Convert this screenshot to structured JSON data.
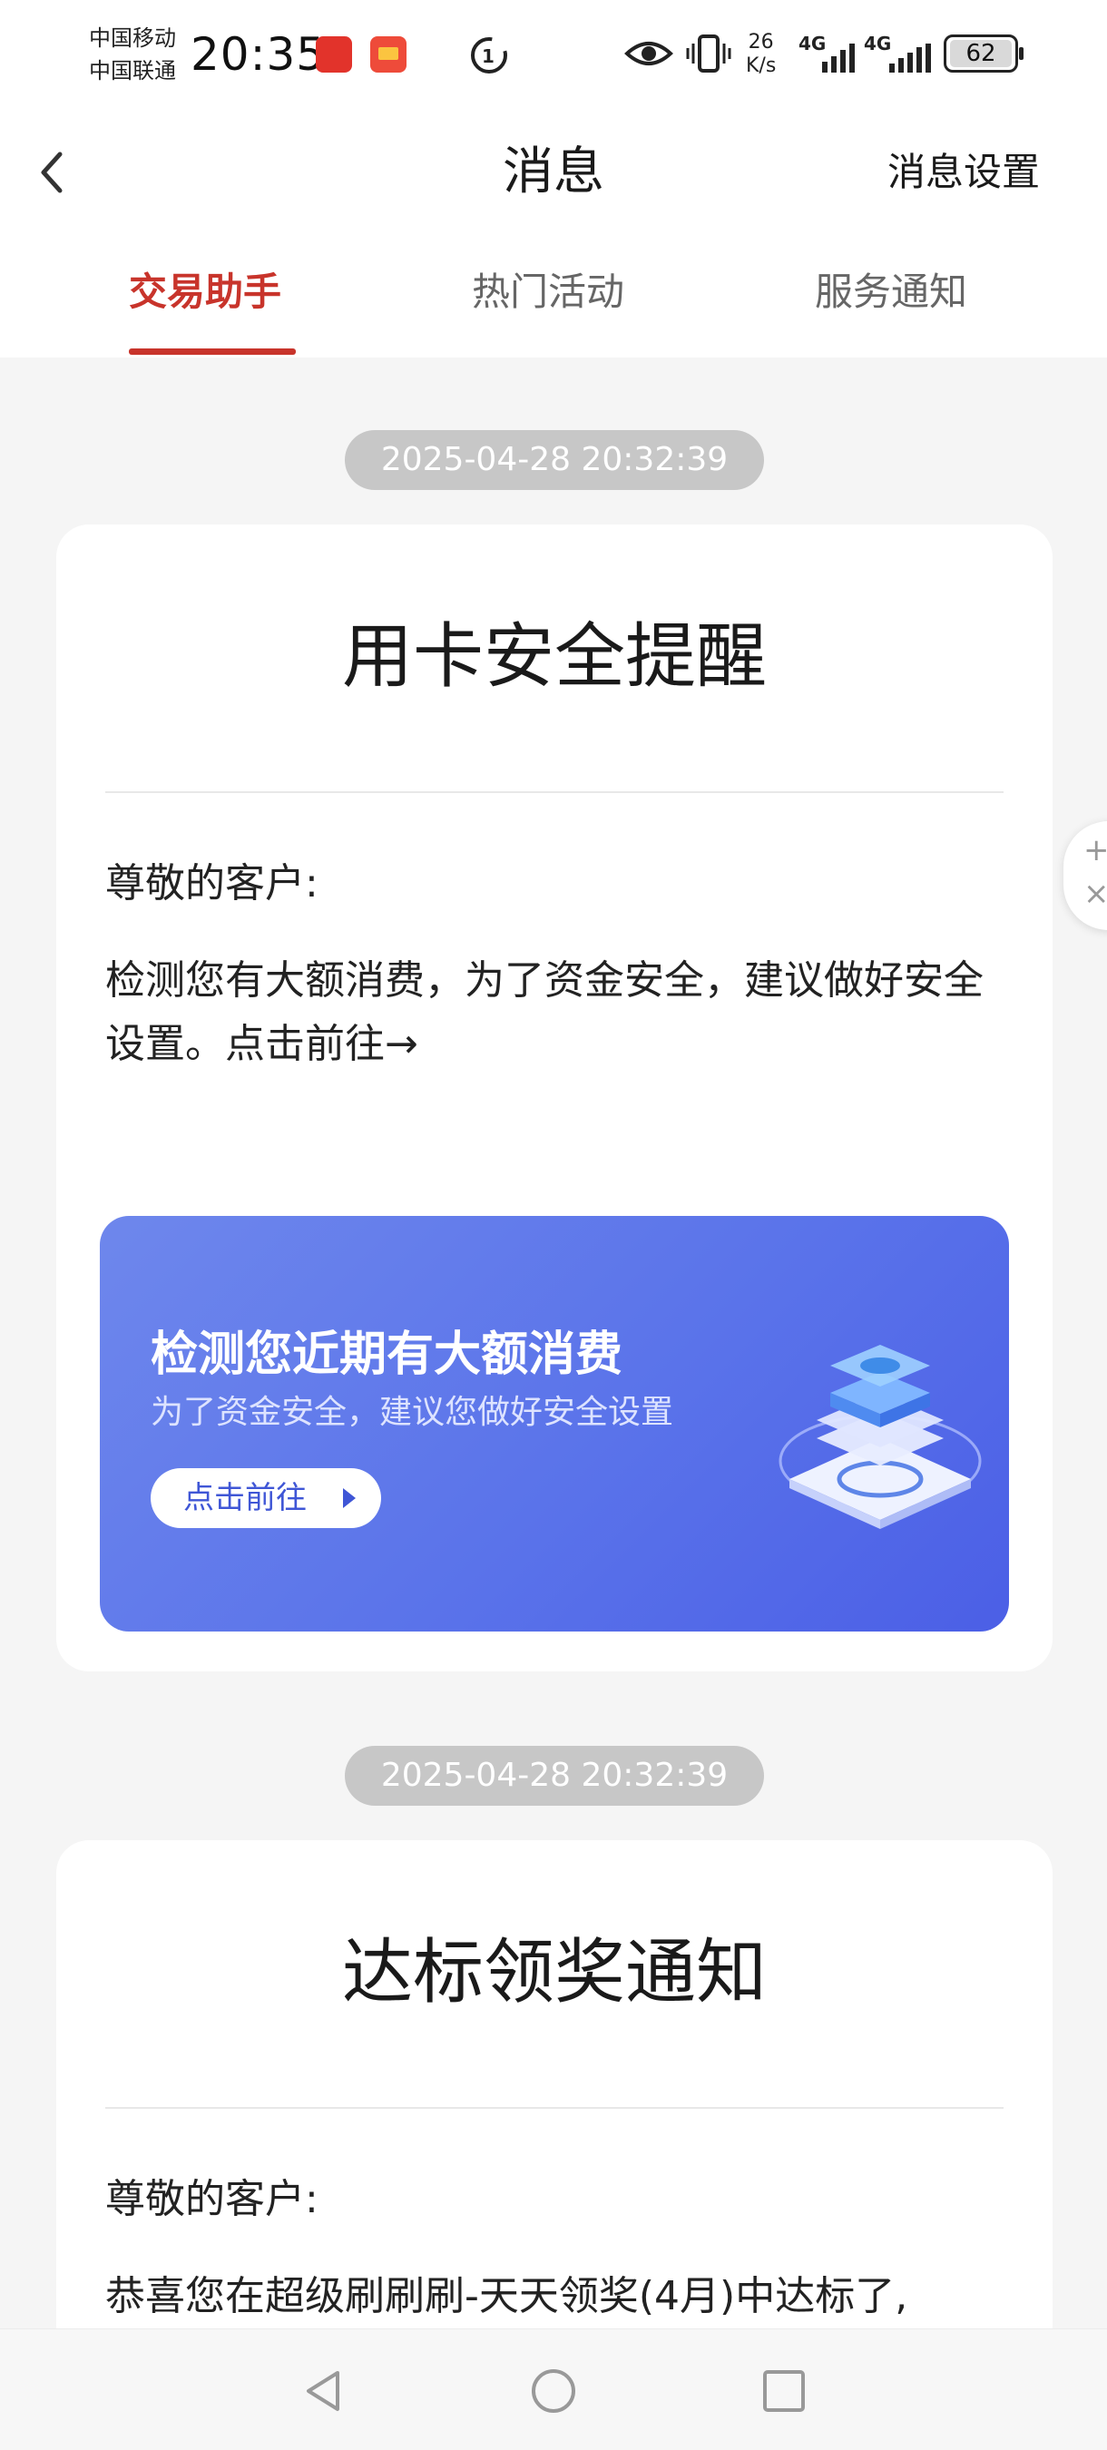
{
  "status_bar": {
    "carrier_1": "中国移动",
    "carrier_2": "中国联通",
    "time": "20:35",
    "net_speed_value": "26",
    "net_speed_unit": "K/s",
    "signal_1": "4G",
    "signal_2": "4G",
    "battery": "62"
  },
  "header": {
    "title": "消息",
    "settings_label": "消息设置"
  },
  "tabs": [
    {
      "label": "交易助手",
      "active": true
    },
    {
      "label": "热门活动",
      "active": false
    },
    {
      "label": "服务通知",
      "active": false
    }
  ],
  "messages": [
    {
      "timestamp": "2025-04-28 20:32:39",
      "title": "用卡安全提醒",
      "greeting": "尊敬的客户:",
      "body": "检测您有大额消费，为了资金安全，建议做好安全设置。点击前往→",
      "banner": {
        "title": "检测您近期有大额消费",
        "subtitle": "为了资金安全，建议您做好安全设置",
        "button_label": "点击前往"
      }
    },
    {
      "timestamp": "2025-04-28 20:32:39",
      "title": "达标领奖通知",
      "greeting": "尊敬的客户:",
      "body": "恭喜您在超级刷刷刷-天天领奖(4月)中达标了,"
    }
  ],
  "colors": {
    "accent": "#c8342b",
    "banner_blue": "#5a73ea",
    "pill_gray": "#c7c7c7",
    "background": "#f5f5f5"
  },
  "icons": {
    "back": "chevron-left-icon",
    "eye": "eye-icon",
    "vibrate": "vibrate-icon",
    "nav_back": "triangle-back-icon",
    "nav_home": "circle-home-icon",
    "nav_recents": "square-recents-icon"
  }
}
